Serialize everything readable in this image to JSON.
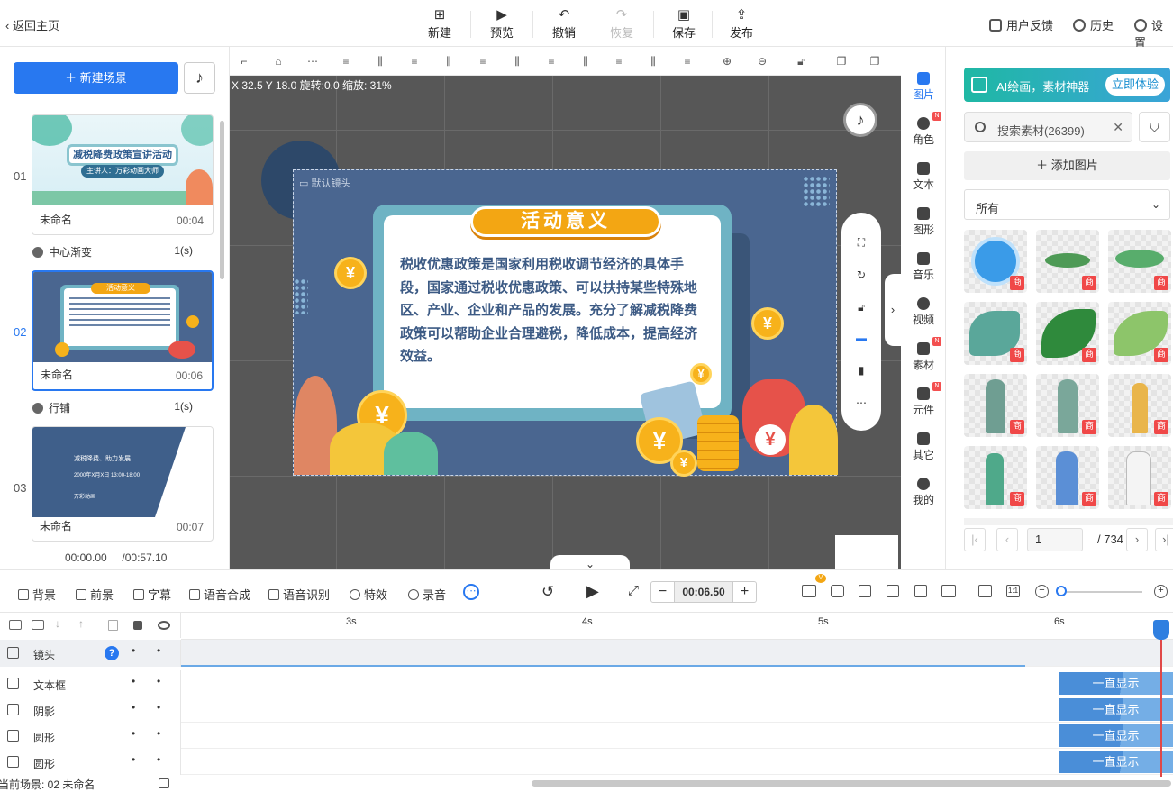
{
  "topbar": {
    "back_label": "返回主页",
    "tools": [
      {
        "label": "新建",
        "icon": "plus-icon"
      },
      {
        "label": "预览",
        "icon": "play-icon"
      },
      {
        "label": "撤销",
        "icon": "undo-icon"
      },
      {
        "label": "恢复",
        "icon": "redo-icon"
      },
      {
        "label": "保存",
        "icon": "save-icon"
      },
      {
        "label": "发布",
        "icon": "publish-icon"
      }
    ],
    "right": {
      "feedback": "用户反馈",
      "history": "历史",
      "settings": "设置"
    }
  },
  "scenes": {
    "new_scene_label": "新建场景",
    "items": [
      {
        "num": "01",
        "name": "未命名",
        "time": "00:04",
        "thumb_title": "减税降费政策宣讲活动",
        "thumb_sub": "主讲人：万彩动画大师",
        "transition": "中心渐变",
        "transition_dur": "1(s)"
      },
      {
        "num": "02",
        "name": "未命名",
        "time": "00:06",
        "thumb_title": "活动意义",
        "transition": "行铺",
        "transition_dur": "1(s)"
      },
      {
        "num": "03",
        "name": "未命名",
        "time": "00:07",
        "thumb_lines": [
          "减税降费、助力发展",
          "2000年X月X日 13:00-18:00",
          "万彩动画"
        ]
      }
    ],
    "playback": {
      "current": "00:00.00",
      "total": "/00:57.10"
    }
  },
  "canvas": {
    "coords": "X 32.5 Y 18.0 旋转:0.0 缩放: 31%",
    "camera_label": "默认镜头",
    "board_title": "活动意义",
    "board_text": "税收优惠政策是国家利用税收调节经济的具体手段，国家通过税收优惠政策、可以扶持某些特殊地区、产业、企业和产品的发展。充分了解减税降费政策可以帮助企业合理避税，降低成本，提高经济效益。",
    "coin_symbol": "¥",
    "colors": {
      "stage_bg": "#4a6690",
      "board": "#6fb3c4",
      "title": "#f3a613",
      "text": "#3c5a84",
      "coin": "#f7b21b"
    }
  },
  "rightnav": [
    {
      "label": "图片",
      "active": true
    },
    {
      "label": "角色",
      "badge": "N"
    },
    {
      "label": "文本"
    },
    {
      "label": "图形"
    },
    {
      "label": "音乐"
    },
    {
      "label": "视频"
    },
    {
      "label": "素材",
      "badge": "N"
    },
    {
      "label": "元件",
      "badge": "N"
    },
    {
      "label": "其它"
    },
    {
      "label": "我的"
    }
  ],
  "assets": {
    "ai_banner": "AI绘画，素材神器",
    "ai_button": "立即体验",
    "search_placeholder": "搜索素材(26399)",
    "add_image": "添加图片",
    "category": "所有",
    "premium_badge": "商",
    "tiles": [
      "clock",
      "leaves",
      "leaves",
      "leaves",
      "leaves",
      "leaves",
      "figure",
      "figure",
      "figure",
      "figure",
      "figure",
      "figure"
    ],
    "page": "1",
    "total_pages": "/ 734"
  },
  "timeline_toolbar": {
    "background": "背景",
    "foreground": "前景",
    "subtitle": "字幕",
    "tts": "语音合成",
    "asr": "语音识别",
    "effects": "特效",
    "record": "录音",
    "time": "00:06.50",
    "minus": "−",
    "plus": "+"
  },
  "timeline": {
    "ticks": [
      "3s",
      "4s",
      "5s",
      "6s"
    ],
    "tracks": [
      {
        "name": "镜头"
      },
      {
        "name": "文本框",
        "clip": "一直显示"
      },
      {
        "name": "阴影",
        "clip": "一直显示"
      },
      {
        "name": "圆形",
        "clip": "一直显示"
      },
      {
        "name": "圆形",
        "clip": "一直显示"
      }
    ],
    "dot": "•",
    "status": "当前场景: 02   未命名"
  }
}
